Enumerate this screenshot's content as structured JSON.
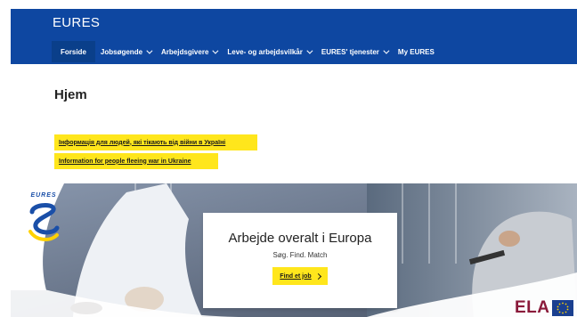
{
  "header": {
    "brand": "EURES",
    "nav": [
      {
        "label": "Forside",
        "dropdown": false,
        "active": true
      },
      {
        "label": "Jobsøgende",
        "dropdown": true,
        "active": false
      },
      {
        "label": "Arbejdsgivere",
        "dropdown": true,
        "active": false
      },
      {
        "label": "Leve- og arbejdsvilkår",
        "dropdown": true,
        "active": false
      },
      {
        "label": "EURES' tjenester",
        "dropdown": true,
        "active": false
      },
      {
        "label": "My EURES",
        "dropdown": false,
        "active": false
      }
    ]
  },
  "page": {
    "title": "Hjem",
    "notices": [
      "Інформація для людей, які тікають від війни в Україні",
      "Information for people fleeing war in Ukraine"
    ]
  },
  "hero": {
    "logo_text": "EURES",
    "card_title": "Arbejde overalt i Europa",
    "card_subtitle": "Søg. Find. Match",
    "cta_label": "Find et job",
    "partner_logo": "ELA"
  },
  "colors": {
    "header_bg": "#0e47a1",
    "accent_yellow": "#ffe61c",
    "ela_red": "#8a1a3a"
  }
}
